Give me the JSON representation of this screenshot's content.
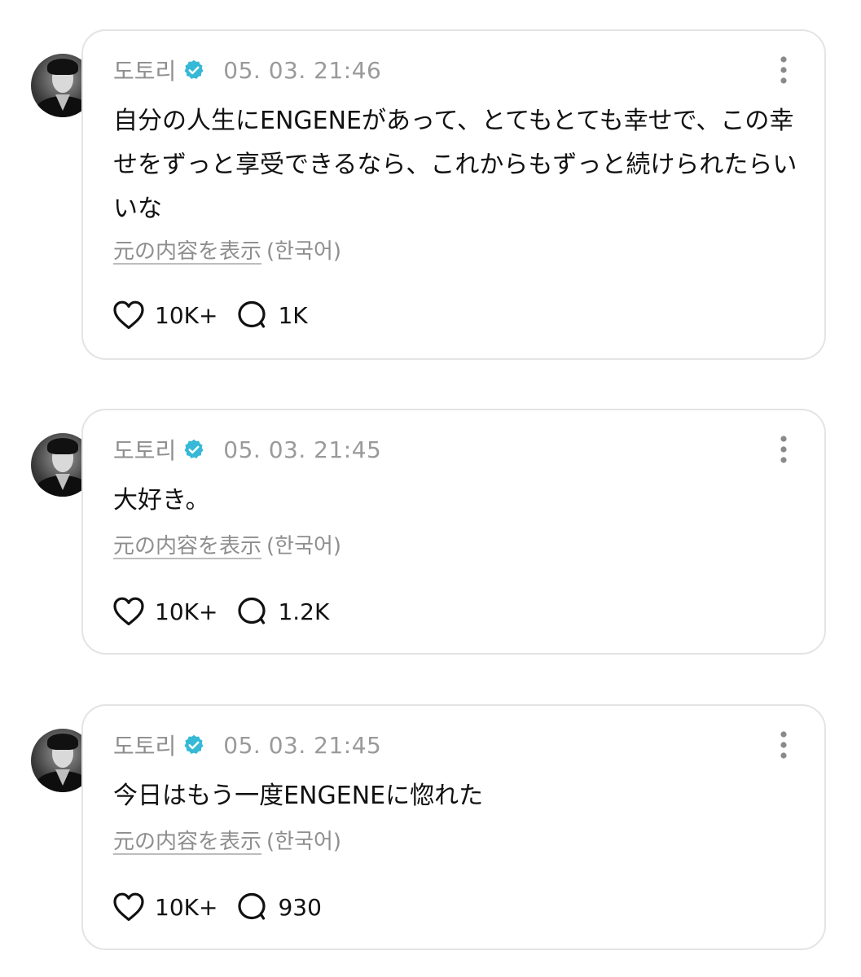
{
  "posts": [
    {
      "username": "도토리",
      "verified_icon": "verified-badge-icon",
      "timestamp": "05. 03. 21:46",
      "text": "自分の人生にENGENEがあって、とてもとても幸せで、この幸せをずっと享受できるなら、これからもずっと続けられたらいいな",
      "translate_label": "元の内容を表示",
      "translate_lang": "(한국어)",
      "likes": "10K+",
      "replies": "1K"
    },
    {
      "username": "도토리",
      "verified_icon": "verified-badge-icon",
      "timestamp": "05. 03. 21:45",
      "text": "大好き。",
      "translate_label": "元の内容を表示",
      "translate_lang": "(한국어)",
      "likes": "10K+",
      "replies": "1.2K"
    },
    {
      "username": "도토리",
      "verified_icon": "verified-badge-icon",
      "timestamp": "05. 03. 21:45",
      "text": "今日はもう一度ENGENEに惚れた",
      "translate_label": "元の内容を表示",
      "translate_lang": "(한국어)",
      "likes": "10K+",
      "replies": "930"
    }
  ],
  "colors": {
    "verified": "#35b9d6",
    "muted_text": "#8e8e8e",
    "card_border": "#e4e4e4"
  }
}
